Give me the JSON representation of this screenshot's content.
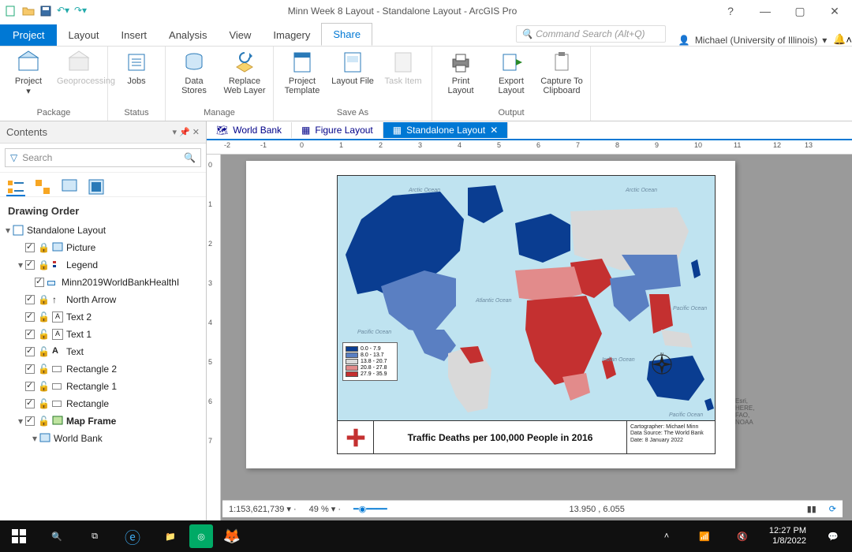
{
  "title": "Minn Week 8 Layout - Standalone Layout - ArcGIS Pro",
  "ribbon": {
    "file_tab": "Project",
    "tabs": [
      "Layout",
      "Insert",
      "Analysis",
      "View",
      "Imagery",
      "Share"
    ],
    "active_tab": "Share",
    "command_search_placeholder": "Command Search (Alt+Q)",
    "user": "Michael (University of Illinois)",
    "groups": {
      "package": {
        "label": "Package",
        "buttons": {
          "project": "Project",
          "geoprocessing": "Geoprocessing"
        }
      },
      "status": {
        "label": "Status",
        "buttons": {
          "jobs": "Jobs"
        }
      },
      "manage": {
        "label": "Manage",
        "buttons": {
          "data_stores": "Data Stores",
          "replace_web_layer": "Replace Web Layer"
        }
      },
      "save_as": {
        "label": "Save As",
        "buttons": {
          "project_template": "Project Template",
          "layout_file": "Layout File",
          "task_item": "Task Item"
        }
      },
      "output": {
        "label": "Output",
        "buttons": {
          "print_layout": "Print Layout",
          "export_layout": "Export Layout",
          "capture_clipboard": "Capture To Clipboard"
        }
      }
    }
  },
  "contents": {
    "title": "Contents",
    "search_placeholder": "Search",
    "header": "Drawing Order",
    "tree": {
      "root": "Standalone Layout",
      "picture": "Picture",
      "legend": "Legend",
      "legend_layer": "Minn2019WorldBankHealthI",
      "north": "North Arrow",
      "text2": "Text 2",
      "text1": "Text 1",
      "text": "Text",
      "rect2": "Rectangle 2",
      "rect1": "Rectangle 1",
      "rect": "Rectangle",
      "map_frame": "Map Frame",
      "map": "World Bank"
    }
  },
  "doc_tabs": [
    "World Bank",
    "Figure Layout",
    "Standalone Layout"
  ],
  "active_doc_tab": "Standalone Layout",
  "ruler_marks": [
    "-2",
    "-1",
    "0",
    "1",
    "2",
    "3",
    "4",
    "5",
    "6",
    "7",
    "8",
    "9",
    "10",
    "11",
    "12",
    "13"
  ],
  "ruler_marks_v": [
    "0",
    "1",
    "2",
    "3",
    "4",
    "5",
    "6",
    "7"
  ],
  "layout": {
    "map_title": "Traffic Deaths per 100,000 People in 2016",
    "meta": {
      "l1": "Cartographer: Michael Minn",
      "l2": "Data Source: The World Bank",
      "l3": "Date: 8 January 2022"
    },
    "legend": [
      {
        "color": "#0a3d91",
        "label": "0.0 - 7.9"
      },
      {
        "color": "#5a7fc2",
        "label": "8.0 - 13.7"
      },
      {
        "color": "#d9d9d9",
        "label": "13.8 - 20.7"
      },
      {
        "color": "#e28b8b",
        "label": "20.8 - 27.8"
      },
      {
        "color": "#c43030",
        "label": "27.9 - 35.9"
      }
    ],
    "credits": "Esri, HERE, FAO, NOAA",
    "ocean_labels": [
      "Arctic Ocean",
      "Arctic Ocean",
      "Atlantic Ocean",
      "Pacific Ocean",
      "Pacific Ocean",
      "Indian Ocean",
      "Pacific Ocean"
    ]
  },
  "statusbar": {
    "scale": "1:153,621,739",
    "zoom": "49 %",
    "coords": "13.950 , 6.055"
  },
  "taskbar": {
    "time": "12:27 PM",
    "date": "1/8/2022"
  },
  "chart_data": {
    "type": "choropleth-map",
    "title": "Traffic Deaths per 100,000 People in 2016",
    "variable": "Road traffic deaths per 100,000 people, 2016",
    "bins": [
      "0.0 - 7.9",
      "8.0 - 13.7",
      "13.8 - 20.7",
      "20.8 - 27.8",
      "27.9 - 35.9"
    ],
    "colors": [
      "#0a3d91",
      "#5a7fc2",
      "#d9d9d9",
      "#e28b8b",
      "#c43030"
    ],
    "region_bin": {
      "Canada": 0,
      "USA": 0,
      "Greenland": 0,
      "Norway": 0,
      "Sweden": 0,
      "UK": 0,
      "France": 0,
      "Germany": 0,
      "Spain": 0,
      "Italy": 0,
      "Japan": 0,
      "Australia": 0,
      "NewZealand": 0,
      "Mexico": 1,
      "Argentina": 1,
      "Chile": 1,
      "Turkey": 1,
      "China": 1,
      "India": 1,
      "Russia": 2,
      "Brazil": 2,
      "Kazakhstan": 2,
      "Peru": 2,
      "Indonesia": 2,
      "Egypt": 2,
      "Iran": 3,
      "SouthAfrica": 3,
      "Morocco": 3,
      "Algeria": 3,
      "Colombia": 3,
      "Bolivia": 3,
      "Vietnam": 3,
      "SaudiArabia": 4,
      "Nigeria": 4,
      "DRC": 4,
      "Sudan": 4,
      "Ethiopia": 4,
      "Tanzania": 4,
      "Mozambique": 4,
      "Madagascar": 4,
      "Venezuela": 4,
      "Thailand": 4,
      "Libya": 4,
      "CentralAfrica": 4
    }
  }
}
